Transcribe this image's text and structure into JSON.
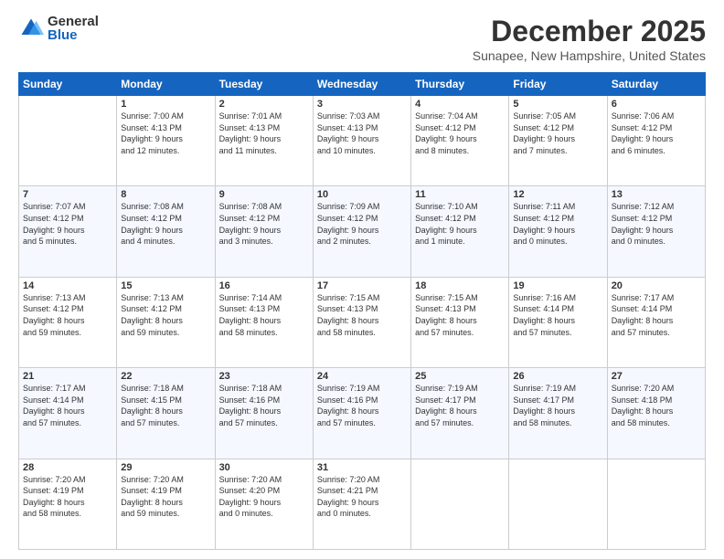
{
  "header": {
    "logo": {
      "general": "General",
      "blue": "Blue"
    },
    "title": "December 2025",
    "location": "Sunapee, New Hampshire, United States"
  },
  "weekdays": [
    "Sunday",
    "Monday",
    "Tuesday",
    "Wednesday",
    "Thursday",
    "Friday",
    "Saturday"
  ],
  "weeks": [
    [
      {
        "day": "",
        "info": ""
      },
      {
        "day": "1",
        "info": "Sunrise: 7:00 AM\nSunset: 4:13 PM\nDaylight: 9 hours\nand 12 minutes."
      },
      {
        "day": "2",
        "info": "Sunrise: 7:01 AM\nSunset: 4:13 PM\nDaylight: 9 hours\nand 11 minutes."
      },
      {
        "day": "3",
        "info": "Sunrise: 7:03 AM\nSunset: 4:13 PM\nDaylight: 9 hours\nand 10 minutes."
      },
      {
        "day": "4",
        "info": "Sunrise: 7:04 AM\nSunset: 4:12 PM\nDaylight: 9 hours\nand 8 minutes."
      },
      {
        "day": "5",
        "info": "Sunrise: 7:05 AM\nSunset: 4:12 PM\nDaylight: 9 hours\nand 7 minutes."
      },
      {
        "day": "6",
        "info": "Sunrise: 7:06 AM\nSunset: 4:12 PM\nDaylight: 9 hours\nand 6 minutes."
      }
    ],
    [
      {
        "day": "7",
        "info": "Sunrise: 7:07 AM\nSunset: 4:12 PM\nDaylight: 9 hours\nand 5 minutes."
      },
      {
        "day": "8",
        "info": "Sunrise: 7:08 AM\nSunset: 4:12 PM\nDaylight: 9 hours\nand 4 minutes."
      },
      {
        "day": "9",
        "info": "Sunrise: 7:08 AM\nSunset: 4:12 PM\nDaylight: 9 hours\nand 3 minutes."
      },
      {
        "day": "10",
        "info": "Sunrise: 7:09 AM\nSunset: 4:12 PM\nDaylight: 9 hours\nand 2 minutes."
      },
      {
        "day": "11",
        "info": "Sunrise: 7:10 AM\nSunset: 4:12 PM\nDaylight: 9 hours\nand 1 minute."
      },
      {
        "day": "12",
        "info": "Sunrise: 7:11 AM\nSunset: 4:12 PM\nDaylight: 9 hours\nand 0 minutes."
      },
      {
        "day": "13",
        "info": "Sunrise: 7:12 AM\nSunset: 4:12 PM\nDaylight: 9 hours\nand 0 minutes."
      }
    ],
    [
      {
        "day": "14",
        "info": "Sunrise: 7:13 AM\nSunset: 4:12 PM\nDaylight: 8 hours\nand 59 minutes."
      },
      {
        "day": "15",
        "info": "Sunrise: 7:13 AM\nSunset: 4:12 PM\nDaylight: 8 hours\nand 59 minutes."
      },
      {
        "day": "16",
        "info": "Sunrise: 7:14 AM\nSunset: 4:13 PM\nDaylight: 8 hours\nand 58 minutes."
      },
      {
        "day": "17",
        "info": "Sunrise: 7:15 AM\nSunset: 4:13 PM\nDaylight: 8 hours\nand 58 minutes."
      },
      {
        "day": "18",
        "info": "Sunrise: 7:15 AM\nSunset: 4:13 PM\nDaylight: 8 hours\nand 57 minutes."
      },
      {
        "day": "19",
        "info": "Sunrise: 7:16 AM\nSunset: 4:14 PM\nDaylight: 8 hours\nand 57 minutes."
      },
      {
        "day": "20",
        "info": "Sunrise: 7:17 AM\nSunset: 4:14 PM\nDaylight: 8 hours\nand 57 minutes."
      }
    ],
    [
      {
        "day": "21",
        "info": "Sunrise: 7:17 AM\nSunset: 4:14 PM\nDaylight: 8 hours\nand 57 minutes."
      },
      {
        "day": "22",
        "info": "Sunrise: 7:18 AM\nSunset: 4:15 PM\nDaylight: 8 hours\nand 57 minutes."
      },
      {
        "day": "23",
        "info": "Sunrise: 7:18 AM\nSunset: 4:16 PM\nDaylight: 8 hours\nand 57 minutes."
      },
      {
        "day": "24",
        "info": "Sunrise: 7:19 AM\nSunset: 4:16 PM\nDaylight: 8 hours\nand 57 minutes."
      },
      {
        "day": "25",
        "info": "Sunrise: 7:19 AM\nSunset: 4:17 PM\nDaylight: 8 hours\nand 57 minutes."
      },
      {
        "day": "26",
        "info": "Sunrise: 7:19 AM\nSunset: 4:17 PM\nDaylight: 8 hours\nand 58 minutes."
      },
      {
        "day": "27",
        "info": "Sunrise: 7:20 AM\nSunset: 4:18 PM\nDaylight: 8 hours\nand 58 minutes."
      }
    ],
    [
      {
        "day": "28",
        "info": "Sunrise: 7:20 AM\nSunset: 4:19 PM\nDaylight: 8 hours\nand 58 minutes."
      },
      {
        "day": "29",
        "info": "Sunrise: 7:20 AM\nSunset: 4:19 PM\nDaylight: 8 hours\nand 59 minutes."
      },
      {
        "day": "30",
        "info": "Sunrise: 7:20 AM\nSunset: 4:20 PM\nDaylight: 9 hours\nand 0 minutes."
      },
      {
        "day": "31",
        "info": "Sunrise: 7:20 AM\nSunset: 4:21 PM\nDaylight: 9 hours\nand 0 minutes."
      },
      {
        "day": "",
        "info": ""
      },
      {
        "day": "",
        "info": ""
      },
      {
        "day": "",
        "info": ""
      }
    ]
  ]
}
